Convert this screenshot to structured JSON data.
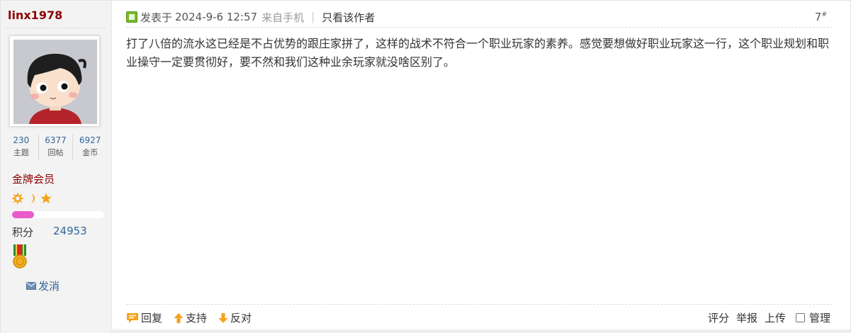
{
  "author": {
    "username": "linx1978",
    "stats": [
      {
        "value": "230",
        "label": "主题"
      },
      {
        "value": "6377",
        "label": "回帖"
      },
      {
        "value": "6927",
        "label": "金币"
      }
    ],
    "rank": "金牌会员",
    "level_icons": [
      "sun-icon",
      "moon-icon",
      "star-icon"
    ],
    "level_progress": 0.24,
    "credit_label": "积分",
    "credit_value": "24953",
    "message_label": "发消"
  },
  "post": {
    "posted_label": "发表于",
    "posted_time": "2024-9-6 12:57",
    "from_label": "来自手机",
    "divider": "|",
    "only_author_label": "只看该作者",
    "floor": "7",
    "floor_mark": "#",
    "body": "打了八倍的流水这已经是不占优势的跟庄家拼了，这样的战术不符合一个职业玩家的素养。感觉要想做好职业玩家这一行，这个职业规划和职业操守一定要贯彻好，要不然和我们这种业余玩家就没啥区别了。"
  },
  "footer": {
    "reply_label": "回复",
    "support_label": "支持",
    "oppose_label": "反对",
    "rate_label": "评分",
    "report_label": "举报",
    "upload_label": "上传",
    "manage_label": "管理"
  },
  "colors": {
    "username": "#8b0000",
    "link": "#336699",
    "progress": "#e85bc9",
    "support_arrow": "#f7a21b",
    "oppose_arrow": "#f7a21b"
  }
}
